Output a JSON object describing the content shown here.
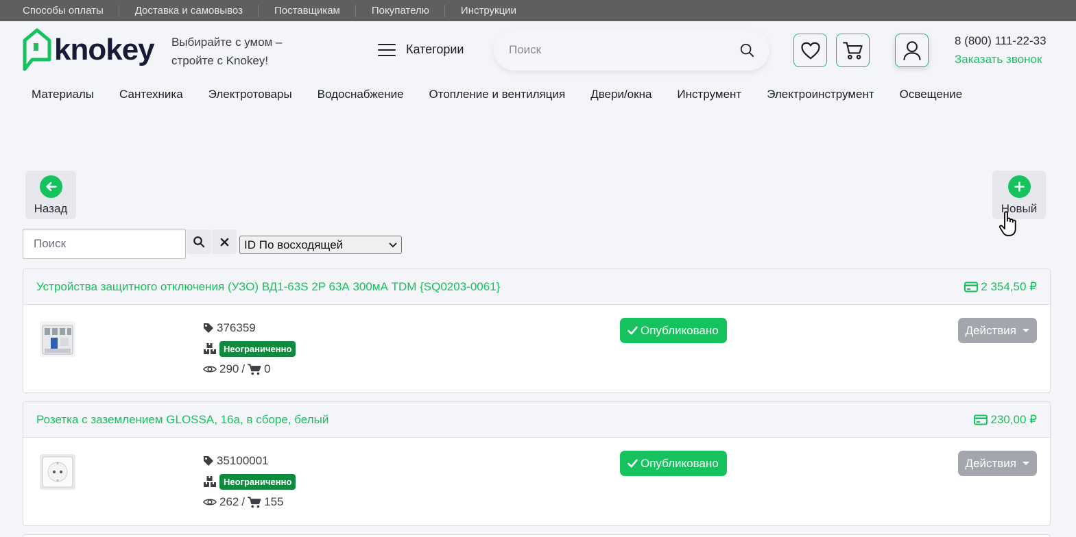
{
  "topbar": {
    "links": [
      "Способы оплаты",
      "Доставка и самовывоз",
      "Поставщикам",
      "Покупателю",
      "Инструкции"
    ]
  },
  "header": {
    "logo_text": "knokey",
    "tagline": "Выбирайте с умом – стройте с Knokey!",
    "categories_label": "Категории",
    "search_placeholder": "Поиск",
    "phone": "8 (800) 111-22-33",
    "callback": "Заказать звонок"
  },
  "nav": {
    "items": [
      "Материалы",
      "Сантехника",
      "Электротовары",
      "Водоснабжение",
      "Отопление и вентиляция",
      "Двери/окна",
      "Инструмент",
      "Электроинструмент",
      "Освещение"
    ]
  },
  "toolbar": {
    "back_label": "Назад",
    "new_label": "Новый"
  },
  "filter": {
    "search_placeholder": "Поиск",
    "sort_value": "ID По восходящей"
  },
  "products": [
    {
      "title": "Устройства защитного отключения (УЗО) ВД1-63S 2P 63А 300мА TDM {SQ0203-0061}",
      "price": "2 354,50 ₽",
      "sku": "376359",
      "stock": "Неограниченно",
      "views": "290",
      "orders": "0",
      "status": "Опубликовано",
      "actions": "Действия"
    },
    {
      "title": "Розетка с заземлением GLOSSA, 16а, в сборе, белый",
      "price": "230,00 ₽",
      "sku": "35100001",
      "stock": "Неограниченно",
      "views": "262",
      "orders": "155",
      "status": "Опубликовано",
      "actions": "Действия"
    }
  ],
  "colors": {
    "accent": "#16c25d",
    "topbar": "#5f5f5f",
    "badge": "#0f8a3f",
    "actions": "#a4a6ae"
  },
  "icons": [
    "logo-icon",
    "burger-icon",
    "search-icon",
    "heart-icon",
    "cart-icon",
    "user-icon",
    "back-arrow-icon",
    "plus-icon",
    "clear-icon",
    "chevron-down-icon",
    "price-card-icon",
    "tag-icon",
    "boxes-icon",
    "eye-icon",
    "cart-small-icon",
    "check-icon",
    "caret-down-icon",
    "hand-cursor-icon"
  ]
}
